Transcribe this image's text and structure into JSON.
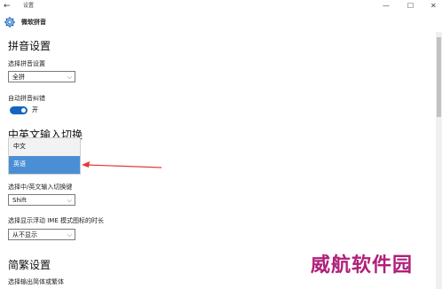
{
  "titlebar": {
    "back_glyph": "←",
    "title": "设置",
    "minimize": "—",
    "maximize": "☐",
    "close": "✕"
  },
  "app_header": {
    "icon": "gear-icon",
    "title": "微软拼音"
  },
  "pinyin": {
    "heading": "拼音设置",
    "select_label": "选择拼音设置",
    "select_value": "全拼",
    "fuzzy_label": "自动拼音纠错",
    "fuzzy_toggle": "开"
  },
  "switch": {
    "heading": "中英文输入切换",
    "dropdown_options": [
      "中文",
      "英语"
    ],
    "selected_option": "英语",
    "key_label": "选择中/英文输入切换键",
    "key_value": "Shift",
    "ime_label": "选择显示浮动 IME 模式图标的时长",
    "ime_value": "从不显示"
  },
  "traditional": {
    "heading": "简繁设置",
    "label": "选择输出简体或繁体"
  },
  "watermark": "威航软件园",
  "colors": {
    "accent": "#1565c0",
    "selection": "#4a8fd6",
    "annotation_arrow": "#e53935",
    "watermark": "#b0207a"
  }
}
